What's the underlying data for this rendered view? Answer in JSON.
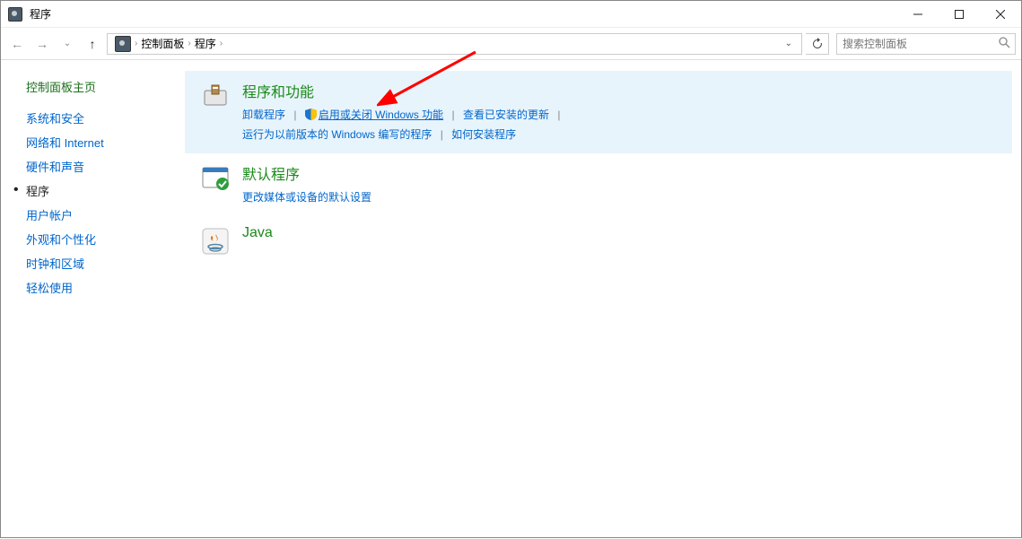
{
  "window": {
    "title": "程序"
  },
  "breadcrumb": {
    "root_sep": "›",
    "items": [
      "控制面板",
      "程序"
    ],
    "sep": "›",
    "dropdown": "⌄"
  },
  "search": {
    "placeholder": "搜索控制面板"
  },
  "sidebar": {
    "title": "控制面板主页",
    "items": [
      {
        "label": "系统和安全"
      },
      {
        "label": "网络和 Internet"
      },
      {
        "label": "硬件和声音"
      },
      {
        "label": "程序",
        "active": true
      },
      {
        "label": "用户帐户"
      },
      {
        "label": "外观和个性化"
      },
      {
        "label": "时钟和区域"
      },
      {
        "label": "轻松使用"
      }
    ]
  },
  "cards": {
    "programs": {
      "title": "程序和功能",
      "link_uninstall": "卸载程序",
      "link_features": "启用或关闭 Windows 功能",
      "link_updates": "查看已安装的更新",
      "link_compat": "运行为以前版本的 Windows 编写的程序",
      "link_howto": "如何安装程序"
    },
    "defaults": {
      "title": "默认程序",
      "link_change": "更改媒体或设备的默认设置"
    },
    "java": {
      "title": "Java"
    }
  }
}
